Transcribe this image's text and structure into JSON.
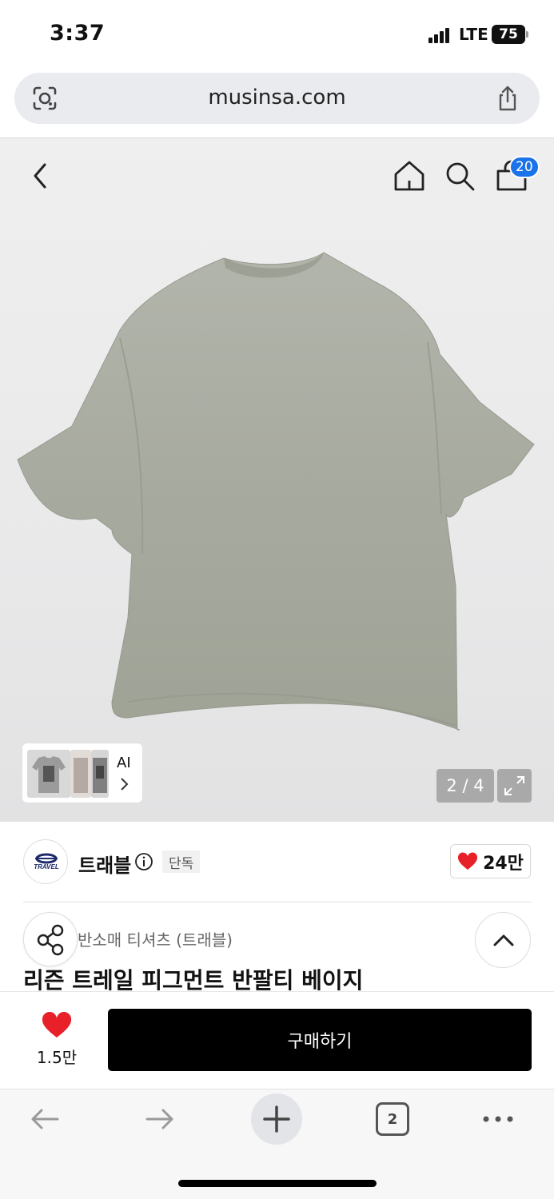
{
  "status": {
    "time": "3:37",
    "network": "LTE",
    "battery": "75"
  },
  "browser": {
    "url": "musinsa.com",
    "tab_count": "2"
  },
  "header": {
    "cart_badge": "20"
  },
  "gallery": {
    "ai_label": "AI",
    "pager": "2 / 4"
  },
  "brand": {
    "name": "트래블",
    "logo_text": "TRAVEL",
    "exclusive_badge": "단독",
    "likes": "24만"
  },
  "product": {
    "category": "반소매 티셔츠 (트래블)",
    "title": "리즌 트레일 피그먼트 반팔티 베이지"
  },
  "purchase": {
    "like_count": "1.5만",
    "buy_label": "구매하기"
  },
  "colors": {
    "accent_blue": "#1a73e8",
    "heart_red": "#e8202a",
    "button_black": "#000000",
    "shirt": "#a9ada2"
  }
}
